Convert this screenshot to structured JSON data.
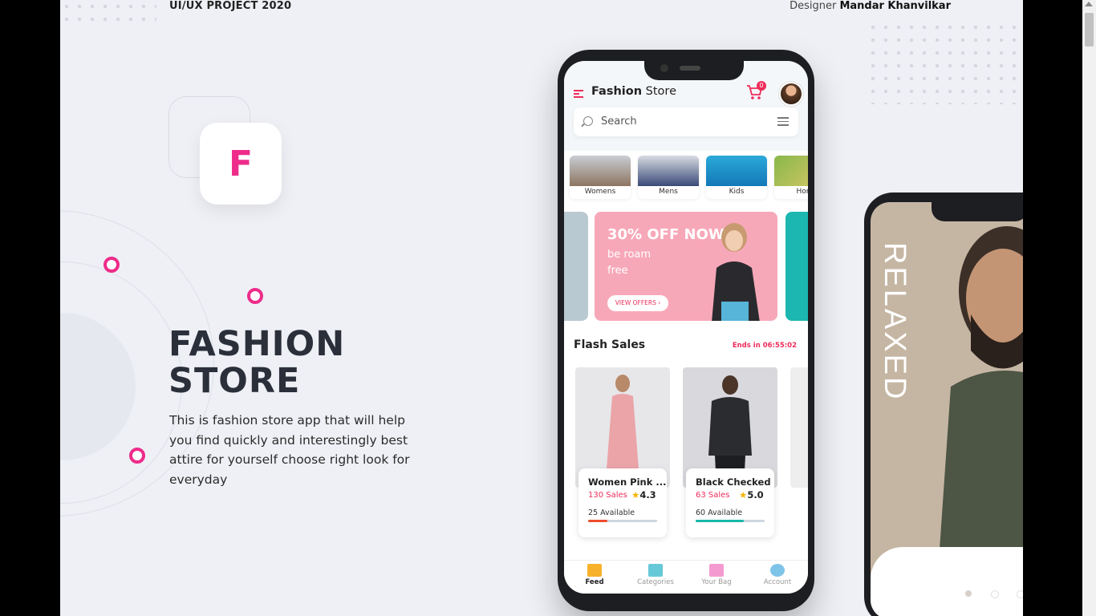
{
  "header": {
    "project": "UI/UX PROJECT 2020",
    "designer_prefix": "Designer",
    "designer_name": "Mandar Khanvilkar"
  },
  "logo": {
    "letter": "F"
  },
  "hero": {
    "title_line1": "FASHION",
    "title_line2": "STORE",
    "description": "This is fashion store app that will help you find quickly and interestingly best attire for yourself choose right look for everyday"
  },
  "app": {
    "brand_bold": "Fashion",
    "brand_rest": "Store",
    "cart_count": "0",
    "search_placeholder": "Search",
    "categories": [
      "Womens",
      "Mens",
      "Kids",
      "Hom"
    ],
    "banner": {
      "headline": "30% OFF NOW",
      "sub": "be roam free",
      "button": "VIEW OFFERS ›"
    },
    "flash": {
      "title": "Flash Sales",
      "ends": "Ends in 06:55:02"
    },
    "products": [
      {
        "name": "Women Pink ...",
        "sales": "130 Sales",
        "rating": "4.3",
        "available": "25 Available",
        "progress": 0.28,
        "color": "#ee4c2c"
      },
      {
        "name": "Black Checked",
        "sales": "63 Sales",
        "rating": "5.0",
        "available": "60 Available",
        "progress": 0.7,
        "color": "#16b8a8"
      }
    ],
    "tabs": [
      "Feed",
      "Categories",
      "Your Bag",
      "Account"
    ]
  },
  "phone2": {
    "brand": "RELAXED"
  },
  "colors": {
    "accent": "#ee2c8a",
    "pink": "#ee2c5a",
    "background": "#eef0f5"
  }
}
